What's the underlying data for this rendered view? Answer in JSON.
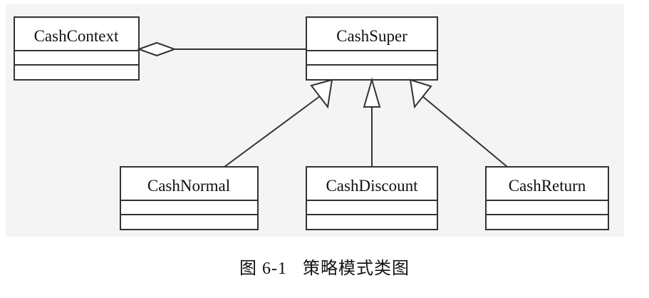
{
  "diagram": {
    "classes": {
      "cash_context": {
        "name": "CashContext"
      },
      "cash_super": {
        "name": "CashSuper"
      },
      "cash_normal": {
        "name": "CashNormal"
      },
      "cash_discount": {
        "name": "CashDiscount"
      },
      "cash_return": {
        "name": "CashReturn"
      }
    },
    "relations": [
      {
        "type": "aggregation",
        "from": "CashContext",
        "to": "CashSuper"
      },
      {
        "type": "generalization",
        "from": "CashNormal",
        "to": "CashSuper"
      },
      {
        "type": "generalization",
        "from": "CashDiscount",
        "to": "CashSuper"
      },
      {
        "type": "generalization",
        "from": "CashReturn",
        "to": "CashSuper"
      }
    ]
  },
  "caption": {
    "figure_number": "图 6-1",
    "title": "策略模式类图"
  }
}
